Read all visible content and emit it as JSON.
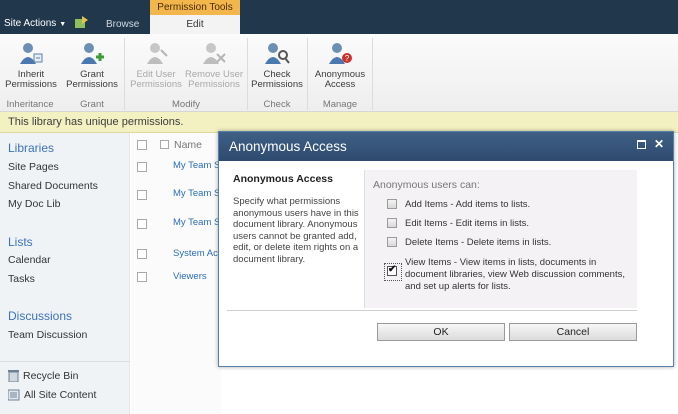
{
  "topbar": {
    "site_actions": "Site Actions",
    "browse_tab": "Browse",
    "contextual_group": "Permission Tools",
    "edit_tab": "Edit"
  },
  "ribbon": {
    "buttons": [
      {
        "label1": "Inherit",
        "label2": "Permissions",
        "icon": "inherit-permissions-icon"
      },
      {
        "label1": "Grant",
        "label2": "Permissions",
        "icon": "grant-permissions-icon"
      },
      {
        "label1": "Edit User",
        "label2": "Permissions",
        "icon": "edit-user-permissions-icon"
      },
      {
        "label1": "Remove User",
        "label2": "Permissions",
        "icon": "remove-user-permissions-icon"
      },
      {
        "label1": "Check",
        "label2": "Permissions",
        "icon": "check-permissions-icon"
      },
      {
        "label1": "Anonymous",
        "label2": "Access",
        "icon": "anonymous-access-icon"
      }
    ],
    "groups": [
      "Inheritance",
      "Grant",
      "Modify",
      "Check",
      "Manage"
    ]
  },
  "status": "This library has unique permissions.",
  "quicklaunch": {
    "libraries_heading": "Libraries",
    "libraries": [
      "Site Pages",
      "Shared Documents",
      "My Doc Lib"
    ],
    "lists_heading": "Lists",
    "lists": [
      "Calendar",
      "Tasks"
    ],
    "discussions_heading": "Discussions",
    "discussions": [
      "Team Discussion"
    ],
    "recycle_bin": "Recycle Bin",
    "all_site_content": "All Site Content"
  },
  "list": {
    "name_header": "Name",
    "rows": [
      "My Team S",
      "My Team S",
      "My Team S",
      "System Acc",
      "Viewers"
    ]
  },
  "dialog": {
    "title": "Anonymous Access",
    "section_title": "Anonymous Access",
    "section_description": "Specify what permissions anonymous users have in this document library. Anonymous users cannot be granted add, edit, or delete item rights on a document library.",
    "header": "Anonymous users can:",
    "options": [
      {
        "text": "Add Items  -  Add items to lists.",
        "checked": false
      },
      {
        "text": "Edit Items  -  Edit items in lists.",
        "checked": false
      },
      {
        "text": "Delete Items  -  Delete items in lists.",
        "checked": false
      },
      {
        "text": "View Items  -  View items in lists, documents in document libraries, view Web discussion comments, and set up alerts for lists.",
        "checked": true
      }
    ],
    "ok_label": "OK",
    "cancel_label": "Cancel"
  }
}
